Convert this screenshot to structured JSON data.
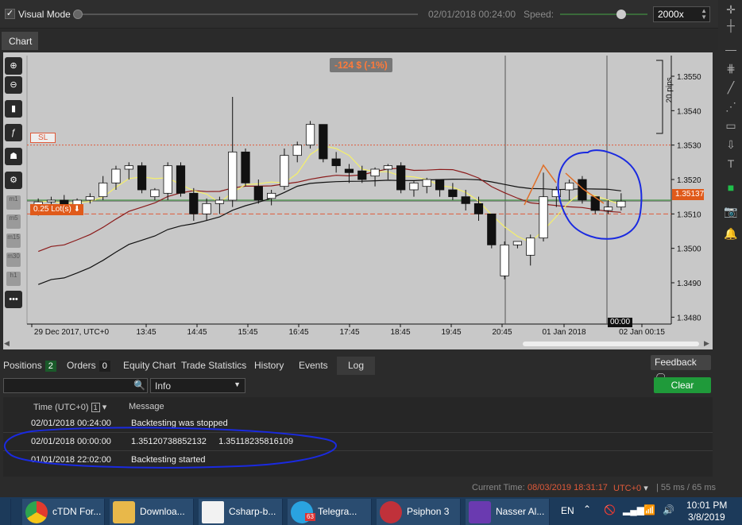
{
  "topbar": {
    "visual_mode_label": "Visual Mode",
    "visual_mode_checked": true,
    "time": "02/01/2018 00:24:00",
    "speed_label": "Speed:",
    "speed_value": "2000x"
  },
  "tabs": {
    "chart": "Chart"
  },
  "chart": {
    "pnl_badge": "-124 $ (-1%)",
    "sl_label": "SL",
    "lots_label": "0.25 Lot(s)",
    "current_price": "1.35137",
    "pips_label": "20 pips",
    "cursor_time": "00:00",
    "y_ticks": [
      "1.3550",
      "1.3540",
      "1.3530",
      "1.3520",
      "1.3510",
      "1.3500",
      "1.3490",
      "1.3480"
    ],
    "x_ticks": [
      "29 Dec 2017, UTC+0",
      "13:45",
      "14:45",
      "15:45",
      "16:45",
      "17:45",
      "18:45",
      "19:45",
      "20:45",
      "01 Jan 2018",
      "02 Jan 00:15"
    ],
    "timeframes": [
      "m1",
      "m5",
      "m15",
      "m30",
      "h1"
    ]
  },
  "chart_data": {
    "type": "candlestick",
    "ylim": [
      1.3478,
      1.3556
    ],
    "x_ticks": [
      "29 Dec 2017, UTC+0",
      "13:45",
      "14:45",
      "15:45",
      "16:45",
      "17:45",
      "18:45",
      "19:45",
      "20:45",
      "01 Jan 2018",
      "02 Jan 00:15"
    ],
    "candles": [
      {
        "o": 1.3511,
        "h": 1.35145,
        "l": 1.35095,
        "c": 1.35135
      },
      {
        "o": 1.35135,
        "h": 1.3515,
        "l": 1.3511,
        "c": 1.3514
      },
      {
        "o": 1.3514,
        "h": 1.35155,
        "l": 1.35105,
        "c": 1.35115
      },
      {
        "o": 1.3512,
        "h": 1.35145,
        "l": 1.351,
        "c": 1.3514
      },
      {
        "o": 1.3514,
        "h": 1.3516,
        "l": 1.3513,
        "c": 1.3515
      },
      {
        "o": 1.3515,
        "h": 1.3521,
        "l": 1.3514,
        "c": 1.3519
      },
      {
        "o": 1.3519,
        "h": 1.3524,
        "l": 1.3517,
        "c": 1.3523
      },
      {
        "o": 1.3523,
        "h": 1.3525,
        "l": 1.352,
        "c": 1.3524
      },
      {
        "o": 1.3524,
        "h": 1.3525,
        "l": 1.3516,
        "c": 1.3517
      },
      {
        "o": 1.3515,
        "h": 1.35175,
        "l": 1.3514,
        "c": 1.3517
      },
      {
        "o": 1.3516,
        "h": 1.3525,
        "l": 1.3514,
        "c": 1.3524
      },
      {
        "o": 1.3524,
        "h": 1.3525,
        "l": 1.3515,
        "c": 1.3516
      },
      {
        "o": 1.3516,
        "h": 1.35175,
        "l": 1.3508,
        "c": 1.351
      },
      {
        "o": 1.351,
        "h": 1.35145,
        "l": 1.3508,
        "c": 1.3513
      },
      {
        "o": 1.3513,
        "h": 1.3515,
        "l": 1.351,
        "c": 1.3514
      },
      {
        "o": 1.3514,
        "h": 1.3544,
        "l": 1.3512,
        "c": 1.3528
      },
      {
        "o": 1.3528,
        "h": 1.3529,
        "l": 1.3518,
        "c": 1.3519
      },
      {
        "o": 1.3518,
        "h": 1.352,
        "l": 1.3513,
        "c": 1.3514
      },
      {
        "o": 1.35145,
        "h": 1.3517,
        "l": 1.35125,
        "c": 1.3516
      },
      {
        "o": 1.3518,
        "h": 1.3529,
        "l": 1.3517,
        "c": 1.3527
      },
      {
        "o": 1.3527,
        "h": 1.3531,
        "l": 1.3525,
        "c": 1.353
      },
      {
        "o": 1.353,
        "h": 1.3537,
        "l": 1.3529,
        "c": 1.3536
      },
      {
        "o": 1.3536,
        "h": 1.3536,
        "l": 1.3525,
        "c": 1.3526
      },
      {
        "o": 1.3526,
        "h": 1.3528,
        "l": 1.3522,
        "c": 1.3524
      },
      {
        "o": 1.3523,
        "h": 1.35245,
        "l": 1.3519,
        "c": 1.3522
      },
      {
        "o": 1.35225,
        "h": 1.3524,
        "l": 1.3519,
        "c": 1.352
      },
      {
        "o": 1.3521,
        "h": 1.35235,
        "l": 1.3518,
        "c": 1.3523
      },
      {
        "o": 1.3523,
        "h": 1.35245,
        "l": 1.352,
        "c": 1.3524
      },
      {
        "o": 1.3524,
        "h": 1.3525,
        "l": 1.3516,
        "c": 1.3517
      },
      {
        "o": 1.3517,
        "h": 1.35195,
        "l": 1.3515,
        "c": 1.3519
      },
      {
        "o": 1.3518,
        "h": 1.35205,
        "l": 1.3516,
        "c": 1.352
      },
      {
        "o": 1.352,
        "h": 1.352,
        "l": 1.3515,
        "c": 1.3517
      },
      {
        "o": 1.3517,
        "h": 1.3519,
        "l": 1.3514,
        "c": 1.3515
      },
      {
        "o": 1.3515,
        "h": 1.3517,
        "l": 1.3511,
        "c": 1.3513
      },
      {
        "o": 1.3513,
        "h": 1.3515,
        "l": 1.3508,
        "c": 1.351
      },
      {
        "o": 1.351,
        "h": 1.351,
        "l": 1.35,
        "c": 1.3501
      },
      {
        "o": 1.3492,
        "h": 1.3502,
        "l": 1.3491,
        "c": 1.3501
      },
      {
        "o": 1.3501,
        "h": 1.3502,
        "l": 1.35,
        "c": 1.3502
      },
      {
        "o": 1.3498,
        "h": 1.3504,
        "l": 1.3495,
        "c": 1.3503
      },
      {
        "o": 1.3503,
        "h": 1.3522,
        "l": 1.3502,
        "c": 1.3515
      },
      {
        "o": 1.3515,
        "h": 1.3518,
        "l": 1.3512,
        "c": 1.3517
      },
      {
        "o": 1.3517,
        "h": 1.352,
        "l": 1.3514,
        "c": 1.3519
      },
      {
        "o": 1.352,
        "h": 1.3521,
        "l": 1.3513,
        "c": 1.3514
      },
      {
        "o": 1.3515,
        "h": 1.3515,
        "l": 1.351,
        "c": 1.3511
      },
      {
        "o": 1.3511,
        "h": 1.3514,
        "l": 1.351,
        "c": 1.3512
      },
      {
        "o": 1.3512,
        "h": 1.3516,
        "l": 1.3511,
        "c": 1.35137
      }
    ],
    "levels": {
      "sl": 1.353,
      "entry": 1.3514,
      "lots_line": 1.351,
      "current": 1.35137
    },
    "colors": {
      "up": "#ffffff",
      "down": "#111111",
      "ma_yellow": "#f5f06a",
      "ma_red": "#8b1a1a",
      "ma_black": "#111111",
      "pnl_text": "#ff7a3a",
      "sl_line": "#e05a3a",
      "entry_line": "#2a8a2a",
      "current_badge": "#e05a1a"
    }
  },
  "bottom_tabs": [
    {
      "label": "Positions",
      "badge": "2"
    },
    {
      "label": "Orders",
      "badge": "0"
    },
    {
      "label": "Equity Chart",
      "badge": ""
    },
    {
      "label": "Trade Statistics",
      "badge": ""
    },
    {
      "label": "History",
      "badge": ""
    },
    {
      "label": "Events",
      "badge": ""
    },
    {
      "label": "Log",
      "badge": ""
    }
  ],
  "feedback_label": "Feedback",
  "log": {
    "search_placeholder": "",
    "filter_value": "Info",
    "clear_label": "Clear",
    "col_time": "Time (UTC+0)",
    "col_time_badge": "1",
    "col_message": "Message",
    "rows": [
      {
        "time": "02/01/2018 00:24:00",
        "message": "Backtesting was stopped"
      },
      {
        "time": "02/01/2018 00:00:00",
        "message": "1.35120738852132     1.35118235816109"
      },
      {
        "time": "01/01/2018 22:02:00",
        "message": "Backtesting started"
      }
    ]
  },
  "status": {
    "current_time_label": "Current Time:",
    "current_time_value": "08/03/2019 18:31:17",
    "tz": "UTC+0",
    "ms": "| 55 ms / 65 ms"
  },
  "taskbar": {
    "items": [
      "cTDN For...",
      "Downloa...",
      "Csharp-b...",
      "Telegra...",
      "Psiphon 3",
      "Nasser Al..."
    ],
    "telegram_badge": "63",
    "lang": "EN",
    "clock_time": "10:01 PM",
    "clock_date": "3/8/2019"
  }
}
